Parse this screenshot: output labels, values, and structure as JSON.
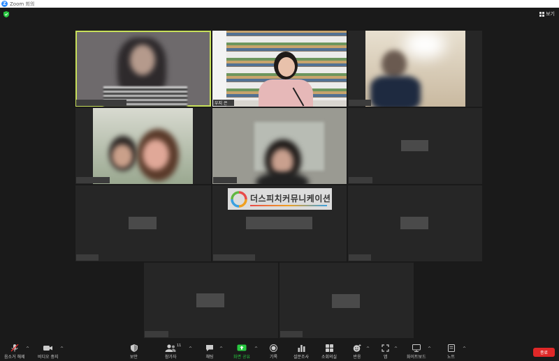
{
  "window": {
    "title": "Zoom 회의"
  },
  "header": {
    "view_label": "보기"
  },
  "watermark": {
    "text": "더스피치커뮤니케이션"
  },
  "participants": {
    "tile2_name": "우지 은"
  },
  "toolbar": {
    "mute_label": "음소거 해제",
    "video_label": "비디오 중지",
    "security_label": "보안",
    "participants_label": "참가자",
    "participants_count": "11",
    "chat_label": "채팅",
    "share_label": "화면 공유",
    "record_label": "기록",
    "poll_label": "설문조사",
    "breakout_label": "소회의실",
    "reactions_label": "반응",
    "apps_label": "앱",
    "whiteboard_label": "화이트보드",
    "notes_label": "노트",
    "end_label": "종료"
  },
  "colors": {
    "active_speaker": "#c8e05a",
    "share": "#28c840",
    "end": "#e02828",
    "brand": "#2d8cff"
  }
}
